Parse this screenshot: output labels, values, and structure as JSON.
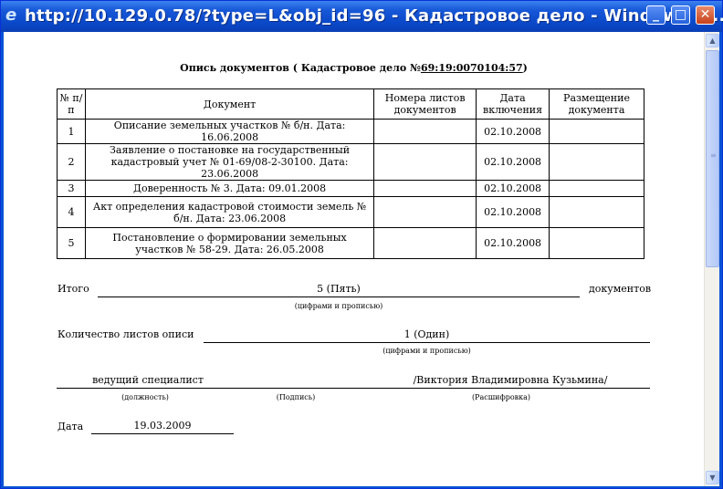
{
  "window": {
    "title": "http://10.129.0.78/?type=L&obj_id=96 - Кадастровое дело - Windows In..."
  },
  "title_buttons": {
    "minimize": "_",
    "maximize": "□",
    "close": "✕"
  },
  "document": {
    "title_prefix": "Опись документов ( Кадастровое дело №",
    "cadastre_number": "69:19:0070104:57",
    "title_suffix": ")",
    "table": {
      "headers": [
        "№ п/п",
        "Документ",
        "Номера листов документов",
        "Дата включения",
        "Размещение документа"
      ],
      "rows": [
        {
          "n": "1",
          "doc": "Описание земельных участков № б/н. Дата: 16.06.2008",
          "sheets": "",
          "date": "02.10.2008",
          "placement": ""
        },
        {
          "n": "2",
          "doc": "Заявление о постановке на государственный кадастровый учет № 01-69/08-2-30100. Дата: 23.06.2008",
          "sheets": "",
          "date": "02.10.2008",
          "placement": ""
        },
        {
          "n": "3",
          "doc": "Доверенность № 3. Дата: 09.01.2008",
          "sheets": "",
          "date": "02.10.2008",
          "placement": ""
        },
        {
          "n": "4",
          "doc": "Акт определения кадастровой стоимости земель № б/н. Дата: 23.06.2008",
          "sheets": "",
          "date": "02.10.2008",
          "placement": ""
        },
        {
          "n": "5",
          "doc": "Постановление о формировании земельных участков № 58-29. Дата: 26.05.2008",
          "sheets": "",
          "date": "02.10.2008",
          "placement": ""
        }
      ]
    },
    "total": {
      "label": "Итого",
      "value": "5 (Пять)",
      "suffix": "документов",
      "hint": "(цифрами и прописью)"
    },
    "sheets_count": {
      "label": "Количество листов описи",
      "value": "1 (Один)",
      "hint": "(цифрами и прописью)"
    },
    "signature": {
      "position": "ведущий специалист",
      "name": "/Виктория Владимировна Кузьмина/",
      "position_hint": "(должность)",
      "signature_hint": "(Подпись)",
      "name_hint": "(Расшифровка)"
    },
    "date": {
      "label": "Дата",
      "value": "19.03.2009"
    }
  }
}
